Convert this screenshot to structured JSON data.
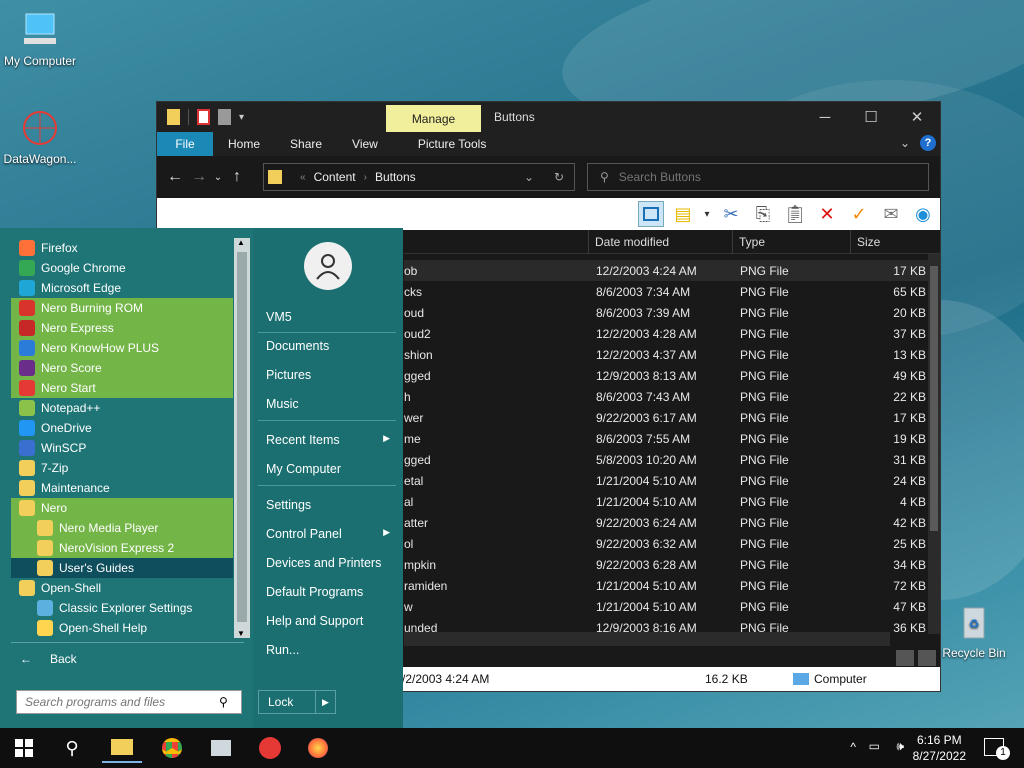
{
  "desktop": {
    "icons": [
      {
        "label": "My Computer"
      },
      {
        "label": "DataWagon..."
      },
      {
        "label": "Recycle Bin"
      }
    ]
  },
  "explorer": {
    "title": "Buttons",
    "manage_tab": "Manage",
    "ribbon_tabs": [
      "File",
      "Home",
      "Share",
      "View",
      "Picture Tools"
    ],
    "address": {
      "segments": [
        "Content",
        "Buttons"
      ],
      "separator": "«"
    },
    "search_placeholder": "Search Buttons",
    "columns": [
      "Date modified",
      "Type",
      "Size"
    ],
    "rows": [
      {
        "name": "ob",
        "date": "12/2/2003 4:24 AM",
        "type": "PNG File",
        "size": "17 KB"
      },
      {
        "name": "cks",
        "date": "8/6/2003 7:34 AM",
        "type": "PNG File",
        "size": "65 KB"
      },
      {
        "name": "oud",
        "date": "8/6/2003 7:39 AM",
        "type": "PNG File",
        "size": "20 KB"
      },
      {
        "name": "oud2",
        "date": "12/2/2003 4:28 AM",
        "type": "PNG File",
        "size": "37 KB"
      },
      {
        "name": "shion",
        "date": "12/2/2003 4:37 AM",
        "type": "PNG File",
        "size": "13 KB"
      },
      {
        "name": "gged",
        "date": "12/9/2003 8:13 AM",
        "type": "PNG File",
        "size": "49 KB"
      },
      {
        "name": "h",
        "date": "8/6/2003 7:43 AM",
        "type": "PNG File",
        "size": "22 KB"
      },
      {
        "name": "wer",
        "date": "9/22/2003 6:17 AM",
        "type": "PNG File",
        "size": "17 KB"
      },
      {
        "name": "me",
        "date": "8/6/2003 7:55 AM",
        "type": "PNG File",
        "size": "19 KB"
      },
      {
        "name": "gged",
        "date": "5/8/2003 10:20 AM",
        "type": "PNG File",
        "size": "31 KB"
      },
      {
        "name": "etal",
        "date": "1/21/2004 5:10 AM",
        "type": "PNG File",
        "size": "24 KB"
      },
      {
        "name": "al",
        "date": "1/21/2004 5:10 AM",
        "type": "PNG File",
        "size": "4 KB"
      },
      {
        "name": "atter",
        "date": "9/22/2003 6:24 AM",
        "type": "PNG File",
        "size": "42 KB"
      },
      {
        "name": "ol",
        "date": "9/22/2003 6:32 AM",
        "type": "PNG File",
        "size": "25 KB"
      },
      {
        "name": "mpkin",
        "date": "9/22/2003 6:28 AM",
        "type": "PNG File",
        "size": "34 KB"
      },
      {
        "name": "ramiden",
        "date": "1/21/2004 5:10 AM",
        "type": "PNG File",
        "size": "72 KB"
      },
      {
        "name": "w",
        "date": "1/21/2004 5:10 AM",
        "type": "PNG File",
        "size": "47 KB"
      },
      {
        "name": "unded",
        "date": "12/9/2003 8:16 AM",
        "type": "PNG File",
        "size": "36 KB"
      }
    ],
    "status": {
      "date": "/2/2003 4:24 AM",
      "size": "16.2 KB",
      "location": "Computer"
    }
  },
  "startmenu": {
    "programs": [
      {
        "label": "Firefox",
        "color": "#ff7139"
      },
      {
        "label": "Google Chrome",
        "color": "#34a853"
      },
      {
        "label": "Microsoft Edge",
        "color": "#1fa5d6"
      },
      {
        "label": "Nero Burning ROM",
        "color": "#d9342b"
      },
      {
        "label": "Nero Express",
        "color": "#c62828"
      },
      {
        "label": "Nero KnowHow PLUS",
        "color": "#2b7bd8"
      },
      {
        "label": "Nero Score",
        "color": "#6b2d8a"
      },
      {
        "label": "Nero Start",
        "color": "#e53935"
      },
      {
        "label": "Notepad++",
        "color": "#8bc34a"
      },
      {
        "label": "OneDrive",
        "color": "#2196f3"
      },
      {
        "label": "WinSCP",
        "color": "#3a6fd0"
      },
      {
        "label": "7-Zip",
        "color": "#f2cf5a"
      },
      {
        "label": "Maintenance",
        "color": "#f2cf5a"
      },
      {
        "label": "Nero",
        "color": "#f2cf5a"
      },
      {
        "label": "Nero Media Player",
        "color": "#f2cf5a"
      },
      {
        "label": "NeroVision Express 2",
        "color": "#f2cf5a"
      },
      {
        "label": "User's Guides",
        "color": "#f2cf5a"
      },
      {
        "label": "Open-Shell",
        "color": "#f2cf5a"
      },
      {
        "label": "Classic Explorer Settings",
        "color": "#5bb0e0"
      },
      {
        "label": "Open-Shell Help",
        "color": "#ffd54f"
      }
    ],
    "back_label": "Back",
    "search_placeholder": "Search programs and files",
    "right_items": [
      "VM5",
      "Documents",
      "Pictures",
      "Music",
      "Recent Items",
      "My Computer",
      "Settings",
      "Control Panel",
      "Devices and Printers",
      "Default Programs",
      "Help and Support",
      "Run..."
    ],
    "lock_label": "Lock"
  },
  "taskbar": {
    "time": "6:16 PM",
    "date": "8/27/2022",
    "notification_count": "1"
  }
}
